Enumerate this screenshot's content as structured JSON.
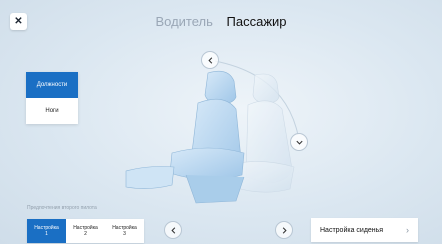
{
  "header": {
    "close_icon": "close-icon",
    "tabs": [
      {
        "label": "Водитель",
        "active": false
      },
      {
        "label": "Пассажир",
        "active": true
      }
    ]
  },
  "side_menu": {
    "items": [
      {
        "label": "Должности",
        "selected": true
      },
      {
        "label": "Ноги",
        "selected": false
      }
    ]
  },
  "controls": {
    "top_chevron": "chevron-left-icon",
    "side_chevron": "chevron-down-icon",
    "prev_icon": "chevron-left-icon",
    "next_icon": "chevron-right-icon"
  },
  "footer": {
    "caption": "Предпочтения второго пилота",
    "presets": [
      {
        "label": "Настройка\n1",
        "selected": true
      },
      {
        "label": "Настройка\n2",
        "selected": false
      },
      {
        "label": "Настройка\n3",
        "selected": false
      }
    ],
    "seat_settings_label": "Настройка сиденья",
    "seat_settings_arrow": "›"
  },
  "colors": {
    "accent": "#1a6fc4",
    "background": "#dbe7f1",
    "seat": "#b7d6f0"
  }
}
